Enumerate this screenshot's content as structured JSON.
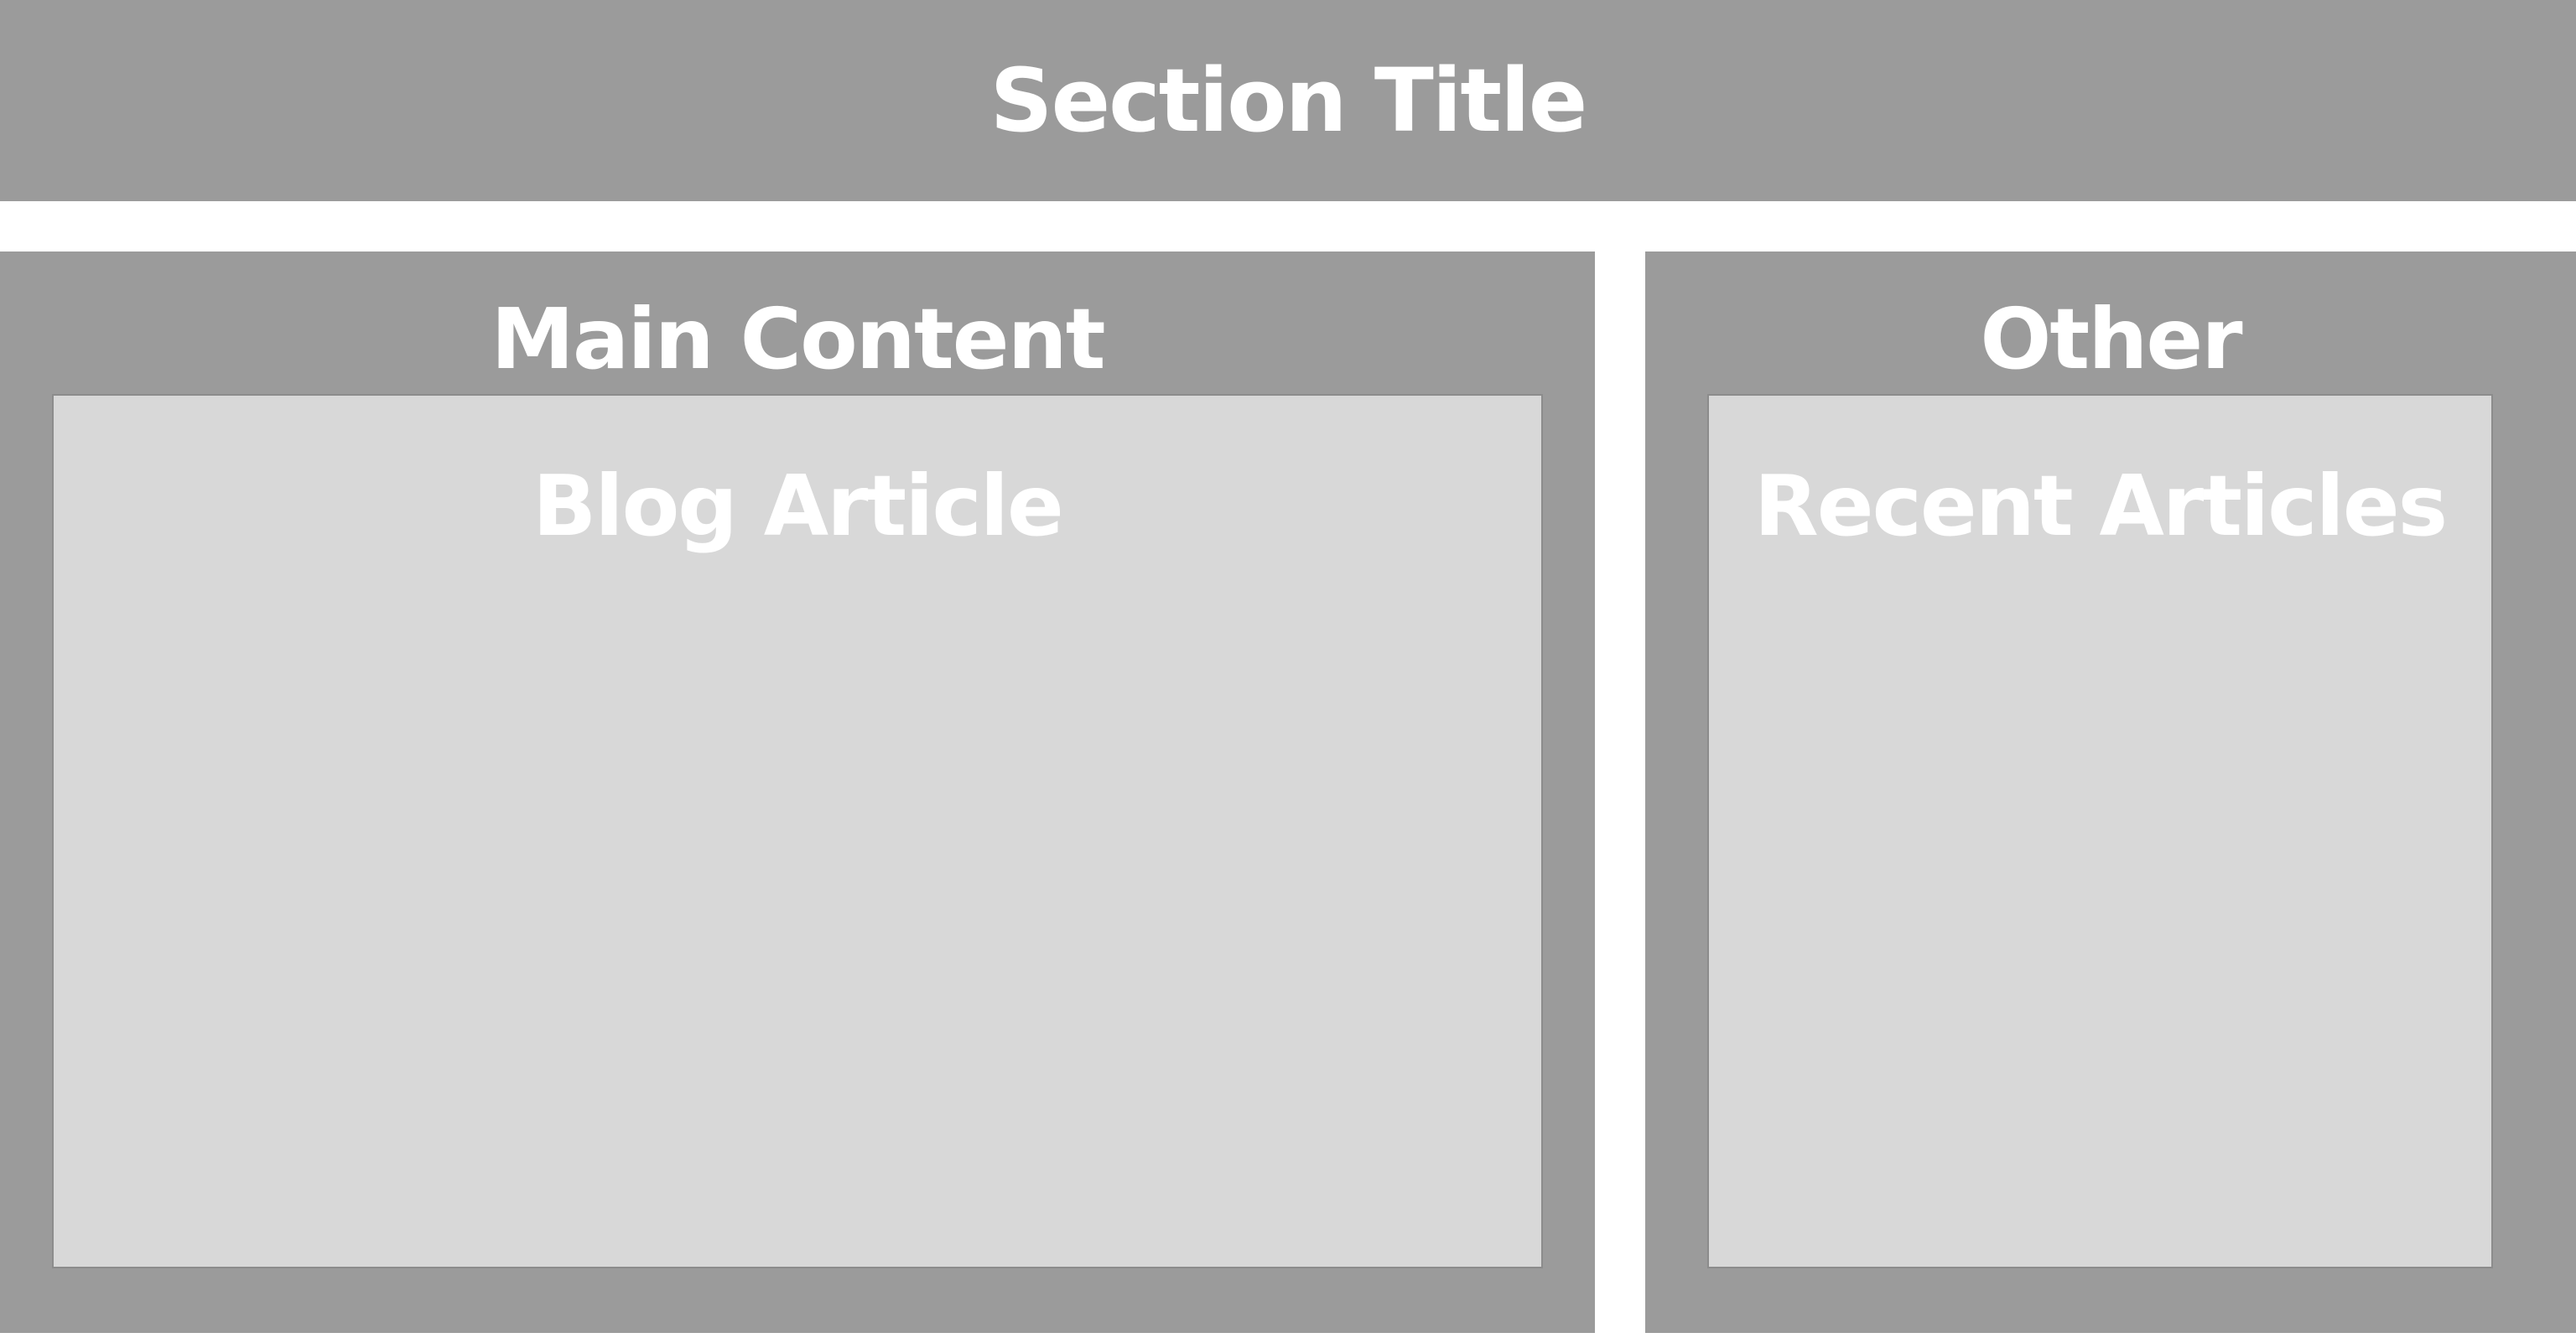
{
  "colors": {
    "outer_block": "#9b9b9b",
    "inner_block": "#d8d8d8",
    "text": "#ffffff",
    "background": "#ffffff"
  },
  "header": {
    "title": "Section Title"
  },
  "main": {
    "title": "Main Content",
    "inner_title": "Blog Article"
  },
  "sidebar": {
    "title": "Other",
    "inner_title": "Recent Articles"
  }
}
